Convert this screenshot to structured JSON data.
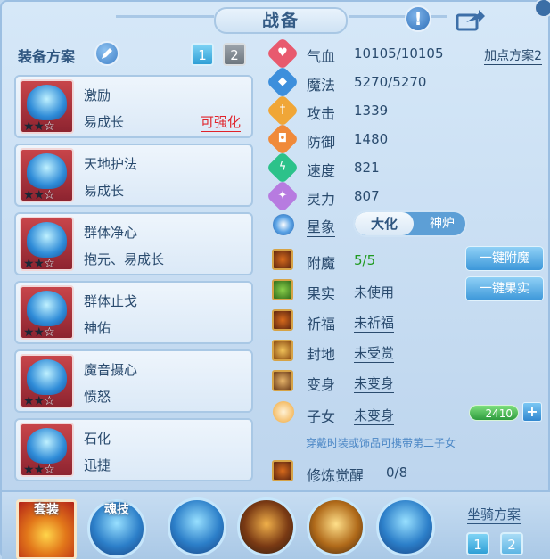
{
  "title": "战备",
  "info_icon": "exclamation-icon",
  "share_icon": "share-icon",
  "equip_scheme": {
    "label": "装备方案",
    "schemes": [
      "1",
      "2"
    ],
    "active": "1"
  },
  "equip_items": [
    {
      "name": "激励",
      "effect": "易成长",
      "upgrade": "可强化",
      "stars": 2
    },
    {
      "name": "天地护法",
      "effect": "易成长",
      "upgrade": "",
      "stars": 2
    },
    {
      "name": "群体净心",
      "effect": "抱元、易成长",
      "upgrade": "",
      "stars": 2
    },
    {
      "name": "群体止戈",
      "effect": "神佑",
      "upgrade": "",
      "stars": 2
    },
    {
      "name": "魔音摄心",
      "effect": "愤怒",
      "upgrade": "",
      "stars": 2
    },
    {
      "name": "石化",
      "effect": "迅捷",
      "upgrade": "",
      "stars": 2
    }
  ],
  "stats": [
    {
      "label": "气血",
      "value": "10105/10105",
      "color": "#e85a6e"
    },
    {
      "label": "魔法",
      "value": "5270/5270",
      "color": "#3d8fdc"
    },
    {
      "label": "攻击",
      "value": "1339",
      "color": "#f0a637"
    },
    {
      "label": "防御",
      "value": "1480",
      "color": "#f08a3a"
    },
    {
      "label": "速度",
      "value": "821",
      "color": "#2cc28a"
    },
    {
      "label": "灵力",
      "value": "807",
      "color": "#b77be0"
    }
  ],
  "add_point": "加点方案2",
  "star_sign": {
    "label": "星象",
    "on": "大化",
    "off": "神炉"
  },
  "features": [
    {
      "label": "附魔",
      "value": "5/5",
      "style": "green",
      "action": "一键附魔"
    },
    {
      "label": "果实",
      "value": "未使用",
      "style": "plain",
      "action": "一键果实"
    },
    {
      "label": "祈福",
      "value": "未祈福",
      "style": "ul",
      "action": ""
    },
    {
      "label": "封地",
      "value": "未受赏",
      "style": "ul",
      "action": ""
    },
    {
      "label": "变身",
      "value": "未变身",
      "style": "ul",
      "action": ""
    }
  ],
  "child": {
    "label": "子女",
    "value": "未变身",
    "points": "2410"
  },
  "hint": "穿戴时装或饰品可携带第二子女",
  "cultivate": {
    "label": "修炼觉醒",
    "value": "0/8"
  },
  "bottom": {
    "suit_label": "套装",
    "soul_label": "魂技",
    "mount_label": "坐骑方案",
    "mount_schemes": [
      "1",
      "2"
    ]
  }
}
